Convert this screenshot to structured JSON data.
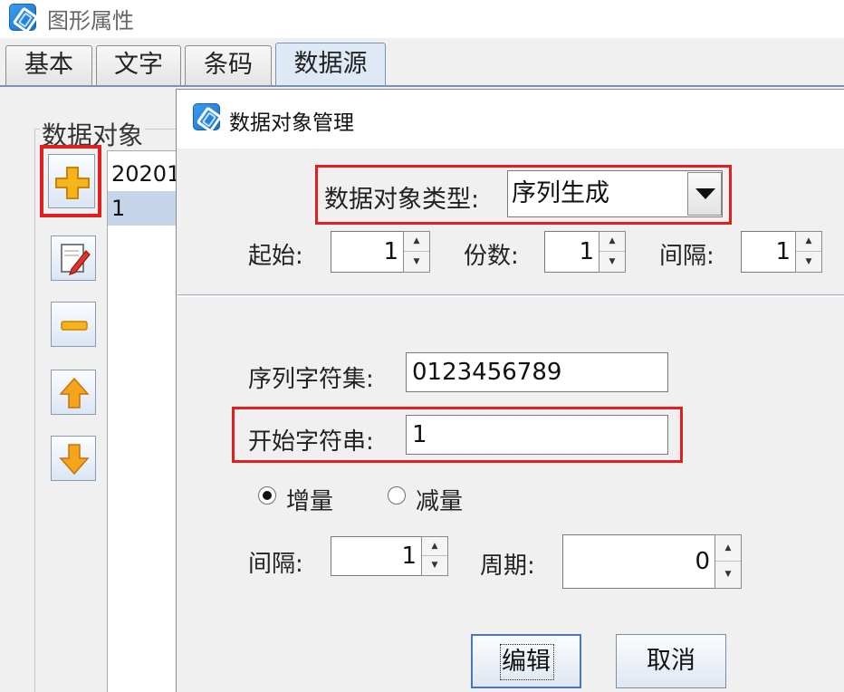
{
  "window": {
    "title": "图形属性"
  },
  "tabs": [
    {
      "label": "基本"
    },
    {
      "label": "文字"
    },
    {
      "label": "条码"
    },
    {
      "label": "数据源"
    }
  ],
  "left_panel": {
    "group_title": "数据对象",
    "tool_icons": [
      "add-icon",
      "edit-icon",
      "remove-icon",
      "move-up-icon",
      "move-down-icon"
    ],
    "list_items": [
      "20201",
      "1"
    ],
    "selected_index": 1
  },
  "dialog": {
    "title": "数据对象管理",
    "type_label": "数据对象类型:",
    "type_value": "序列生成",
    "start_label": "起始:",
    "start_value": "1",
    "copies_label": "份数:",
    "copies_value": "1",
    "interval_label": "间隔:",
    "interval_value": "1",
    "charset_label": "序列字符集:",
    "charset_value": "0123456789",
    "start_string_label": "开始字符串:",
    "start_string_value": "1",
    "increment_label": "增量",
    "decrement_label": "减量",
    "increment_selected": true,
    "step_label": "间隔:",
    "step_value": "1",
    "period_label": "周期:",
    "period_value": "0",
    "edit_button": "编辑",
    "cancel_button": "取消"
  },
  "colors": {
    "highlight_red": "#e02020",
    "tab_active": "#dfe9f5",
    "list_selected": "#c5d5ea"
  }
}
